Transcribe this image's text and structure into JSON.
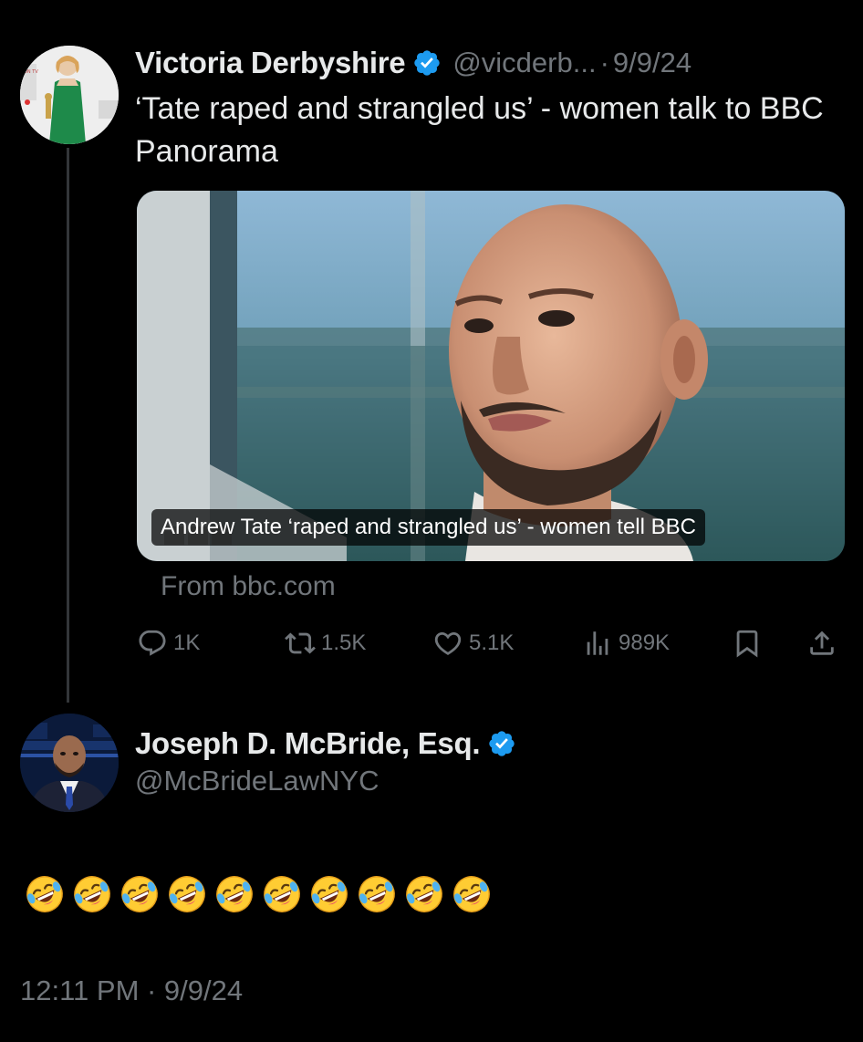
{
  "original_tweet": {
    "author_name": "Victoria Derbyshire",
    "handle": "@vicderb...",
    "separator": "·",
    "date": "9/9/24",
    "text": "‘Tate raped and strangled us’ - women talk to BBC Panorama",
    "link_card": {
      "caption": "Andrew Tate ‘raped and strangled us’ - women tell BBC",
      "source": "From bbc.com"
    },
    "actions": {
      "replies": "1K",
      "retweets": "1.5K",
      "likes": "5.1K",
      "views": "989K"
    }
  },
  "reply": {
    "author_name": "Joseph D. McBride, Esq.",
    "handle": "@McBrideLawNYC",
    "emoji_count": 10,
    "timestamp": "12:11 PM · 9/9/24"
  },
  "colors": {
    "background": "#000000",
    "primary_text": "#e7e9ea",
    "secondary_text": "#71767b",
    "verified_badge": "#1d9bf0",
    "thread_line": "#333639"
  },
  "icons": {
    "verified": "verified-badge-icon",
    "reply": "reply-icon",
    "retweet": "retweet-icon",
    "like": "heart-icon",
    "views": "views-icon",
    "bookmark": "bookmark-icon",
    "share": "share-icon",
    "emoji": "rolling-on-floor-laughing-emoji"
  }
}
